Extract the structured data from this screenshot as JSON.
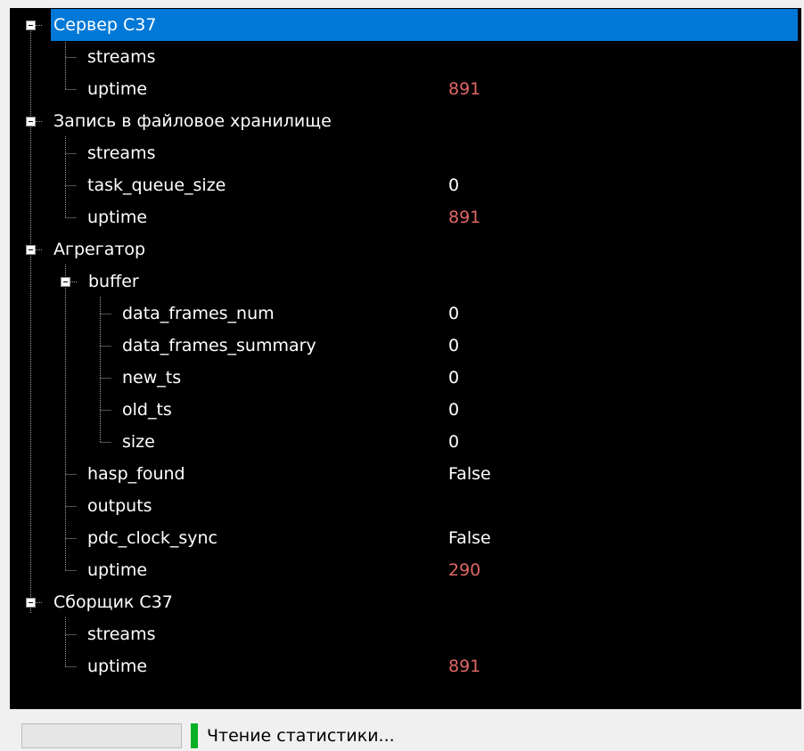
{
  "tree": {
    "nodes": [
      {
        "label": "Сервер С37",
        "value": "",
        "red": false
      },
      {
        "label": "streams",
        "value": "",
        "red": false
      },
      {
        "label": "uptime",
        "value": "891",
        "red": true
      },
      {
        "label": "Запись в файловое хранилище",
        "value": "",
        "red": false
      },
      {
        "label": "streams",
        "value": "",
        "red": false
      },
      {
        "label": "task_queue_size",
        "value": "0",
        "red": false
      },
      {
        "label": "uptime",
        "value": "891",
        "red": true
      },
      {
        "label": "Агрегатор",
        "value": "",
        "red": false
      },
      {
        "label": "buffer",
        "value": "",
        "red": false
      },
      {
        "label": "data_frames_num",
        "value": "0",
        "red": false
      },
      {
        "label": "data_frames_summary",
        "value": "0",
        "red": false
      },
      {
        "label": "new_ts",
        "value": "0",
        "red": false
      },
      {
        "label": "old_ts",
        "value": "0",
        "red": false
      },
      {
        "label": "size",
        "value": "0",
        "red": false
      },
      {
        "label": "hasp_found",
        "value": "False",
        "red": false
      },
      {
        "label": "outputs",
        "value": "",
        "red": false
      },
      {
        "label": "pdc_clock_sync",
        "value": "False",
        "red": false
      },
      {
        "label": "uptime",
        "value": "290",
        "red": true
      },
      {
        "label": "Сборщик С37",
        "value": "",
        "red": false
      },
      {
        "label": "streams",
        "value": "",
        "red": false
      },
      {
        "label": "uptime",
        "value": "891",
        "red": true
      }
    ]
  },
  "status": {
    "text": "Чтение статистики...",
    "progress_fraction": 0
  },
  "colors": {
    "selection": "#0078d7",
    "tree_background": "#000000",
    "uptime_value": "#e06666",
    "status_indicator": "#06b025"
  }
}
